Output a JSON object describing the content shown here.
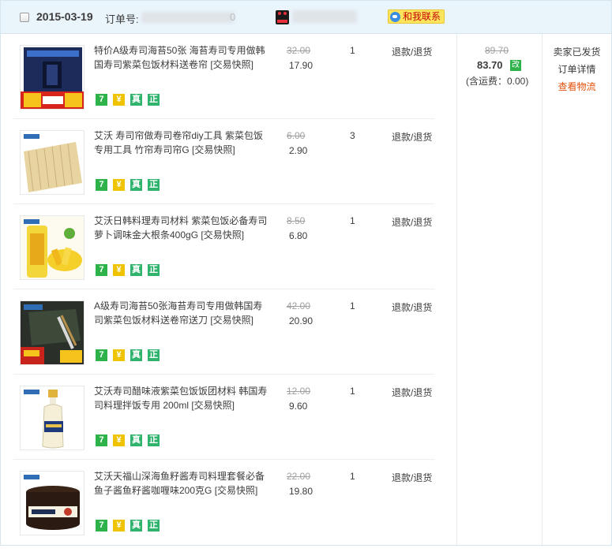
{
  "order": {
    "date": "2015-03-19",
    "order_no_label": "订单号:",
    "order_no_tail": "0",
    "contact_label": "和我联系"
  },
  "items": [
    {
      "title": "特价A级寿司海苔50张 海苔寿司专用做韩国寿司紫菜包饭材料送卷帘 [交易快照]",
      "original_price": "32.00",
      "price": "17.90",
      "quantity": "1",
      "service": "退款/退货"
    },
    {
      "title": "艾沃 寿司帘做寿司卷帘diy工具 紫菜包饭专用工具 竹帘寿司帘G [交易快照]",
      "original_price": "6.00",
      "price": "2.90",
      "quantity": "3",
      "service": "退款/退货"
    },
    {
      "title": "艾沃日韩料理寿司材料 紫菜包饭必备寿司萝卜调味金大根条400gG [交易快照]",
      "original_price": "8.50",
      "price": "6.80",
      "quantity": "1",
      "service": "退款/退货"
    },
    {
      "title": "A级寿司海苔50张海苔寿司专用做韩国寿司紫菜包饭材料送卷帘送刀 [交易快照]",
      "original_price": "42.00",
      "price": "20.90",
      "quantity": "1",
      "service": "退款/退货"
    },
    {
      "title": "艾沃寿司醋味液紫菜包饭饭团材料 韩国寿司料理拌饭专用 200ml [交易快照]",
      "original_price": "12.00",
      "price": "9.60",
      "quantity": "1",
      "service": "退款/退货"
    },
    {
      "title": "艾沃天福山深海鱼籽酱寿司料理套餐必备鱼子酱鱼籽酱咖喱味200克G [交易快照]",
      "original_price": "22.00",
      "price": "19.80",
      "quantity": "1",
      "service": "退款/退货"
    }
  ],
  "badges": {
    "seven": "7",
    "rmb": "¥",
    "zhen": "真",
    "zheng": "正"
  },
  "total": {
    "original": "89.70",
    "paid": "83.70",
    "change_mark": "改",
    "shipping": "(含运费：0.00)"
  },
  "status": {
    "state": "卖家已发货",
    "detail_link": "订单详情",
    "logistics_link": "查看物流"
  },
  "colors": {
    "header_bg": "#eaf4fb",
    "link": "#e4510a",
    "badge_green": "#2db34a",
    "badge_yellow": "#f0c300"
  }
}
